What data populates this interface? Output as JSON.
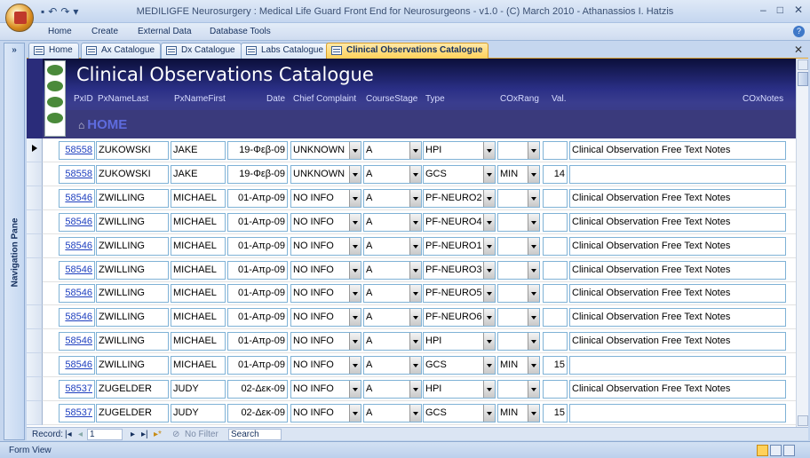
{
  "app": {
    "title": "MEDILIGFE Neurosurgery : Medical Life Guard Front End for Neurosurgeons - v1.0 - (C) March 2010 - Athanassios I. Hatzis"
  },
  "ribbon_tabs": [
    "Home",
    "Create",
    "External Data",
    "Database Tools"
  ],
  "nav_pane": {
    "label": "Navigation Pane",
    "expand": "»"
  },
  "doc_tabs": [
    "Home",
    "Ax Catalogue",
    "Dx Catalogue",
    "Labs Catalogue",
    "Clinical Observations Catalogue"
  ],
  "form": {
    "title": "Clinical Observations Catalogue",
    "home_link": "HOME",
    "columns": {
      "pxid": "PxID",
      "last": "PxNameLast",
      "first": "PxNameFirst",
      "date": "Date",
      "complaint": "Chief Complaint",
      "stage": "CourseStage",
      "type": "Type",
      "rang": "COxRang",
      "val": "Val.",
      "notes": "COxNotes"
    }
  },
  "rows": [
    {
      "pxid": "58558",
      "last": "ZUKOWSKI",
      "first": "JAKE",
      "date": "19-Φεβ-09",
      "complaint": "UNKNOWN",
      "stage": "A",
      "type": "HPI",
      "rang": "",
      "val": "",
      "notes": "Clinical Observation Free Text Notes"
    },
    {
      "pxid": "58558",
      "last": "ZUKOWSKI",
      "first": "JAKE",
      "date": "19-Φεβ-09",
      "complaint": "UNKNOWN",
      "stage": "A",
      "type": "GCS",
      "rang": "MIN",
      "val": "14",
      "notes": ""
    },
    {
      "pxid": "58546",
      "last": "ZWILLING",
      "first": "MICHAEL",
      "date": "01-Απρ-09",
      "complaint": "NO INFO",
      "stage": "A",
      "type": "PF-NEURO2",
      "rang": "",
      "val": "",
      "notes": "Clinical Observation Free Text Notes"
    },
    {
      "pxid": "58546",
      "last": "ZWILLING",
      "first": "MICHAEL",
      "date": "01-Απρ-09",
      "complaint": "NO INFO",
      "stage": "A",
      "type": "PF-NEURO4",
      "rang": "",
      "val": "",
      "notes": "Clinical Observation Free Text Notes"
    },
    {
      "pxid": "58546",
      "last": "ZWILLING",
      "first": "MICHAEL",
      "date": "01-Απρ-09",
      "complaint": "NO INFO",
      "stage": "A",
      "type": "PF-NEURO1",
      "rang": "",
      "val": "",
      "notes": "Clinical Observation Free Text Notes"
    },
    {
      "pxid": "58546",
      "last": "ZWILLING",
      "first": "MICHAEL",
      "date": "01-Απρ-09",
      "complaint": "NO INFO",
      "stage": "A",
      "type": "PF-NEURO3",
      "rang": "",
      "val": "",
      "notes": "Clinical Observation Free Text Notes"
    },
    {
      "pxid": "58546",
      "last": "ZWILLING",
      "first": "MICHAEL",
      "date": "01-Απρ-09",
      "complaint": "NO INFO",
      "stage": "A",
      "type": "PF-NEURO5",
      "rang": "",
      "val": "",
      "notes": "Clinical Observation Free Text Notes"
    },
    {
      "pxid": "58546",
      "last": "ZWILLING",
      "first": "MICHAEL",
      "date": "01-Απρ-09",
      "complaint": "NO INFO",
      "stage": "A",
      "type": "PF-NEURO6",
      "rang": "",
      "val": "",
      "notes": "Clinical Observation Free Text Notes"
    },
    {
      "pxid": "58546",
      "last": "ZWILLING",
      "first": "MICHAEL",
      "date": "01-Απρ-09",
      "complaint": "NO INFO",
      "stage": "A",
      "type": "HPI",
      "rang": "",
      "val": "",
      "notes": "Clinical Observation Free Text Notes"
    },
    {
      "pxid": "58546",
      "last": "ZWILLING",
      "first": "MICHAEL",
      "date": "01-Απρ-09",
      "complaint": "NO INFO",
      "stage": "A",
      "type": "GCS",
      "rang": "MIN",
      "val": "15",
      "notes": ""
    },
    {
      "pxid": "58537",
      "last": "ZUGELDER",
      "first": "JUDY",
      "date": "02-Δεκ-09",
      "complaint": "NO INFO",
      "stage": "A",
      "type": "HPI",
      "rang": "",
      "val": "",
      "notes": "Clinical Observation Free Text Notes"
    },
    {
      "pxid": "58537",
      "last": "ZUGELDER",
      "first": "JUDY",
      "date": "02-Δεκ-09",
      "complaint": "NO INFO",
      "stage": "A",
      "type": "GCS",
      "rang": "MIN",
      "val": "15",
      "notes": ""
    }
  ],
  "record_nav": {
    "label": "Record:",
    "current": "1",
    "filter": "No Filter",
    "search": "Search"
  },
  "status": {
    "view": "Form View"
  }
}
